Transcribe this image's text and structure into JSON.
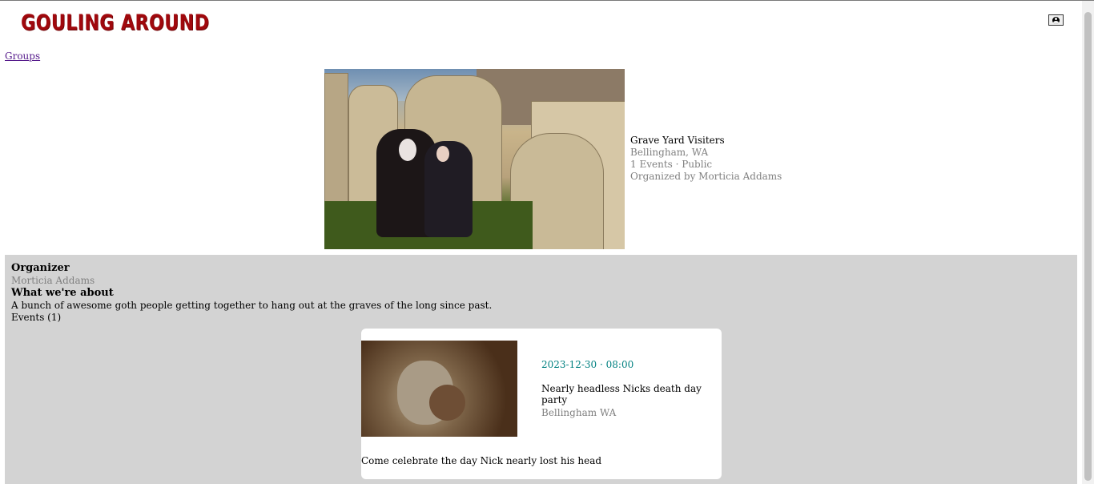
{
  "header": {
    "logo_text": "GOULING AROUND",
    "profile_icon": "user-circle-icon"
  },
  "nav": {
    "groups_link": "Groups"
  },
  "group": {
    "name": "Grave Yard Visiters",
    "location": "Bellingham, WA",
    "meta": "1 Events · Public",
    "organized_by": "Organized by Morticia Addams"
  },
  "details": {
    "organizer_heading": "Organizer",
    "organizer_name": "Morticia Addams",
    "about_heading": "What we're about",
    "about_text": "A bunch of awesome goth people getting together to hang out at the graves of the long since past.",
    "events_heading": "Events (1)"
  },
  "events": [
    {
      "datetime": "2023-12-30 · 08:00",
      "title": "Nearly headless Nicks death day party",
      "location": "Bellingham WA",
      "description": "Come celebrate the day Nick nearly lost his head"
    }
  ],
  "colors": {
    "logo": "#a0080d",
    "panel_bg": "#d3d3d3",
    "event_date": "#008080",
    "muted_text": "#808080",
    "link": "#551a8b"
  }
}
